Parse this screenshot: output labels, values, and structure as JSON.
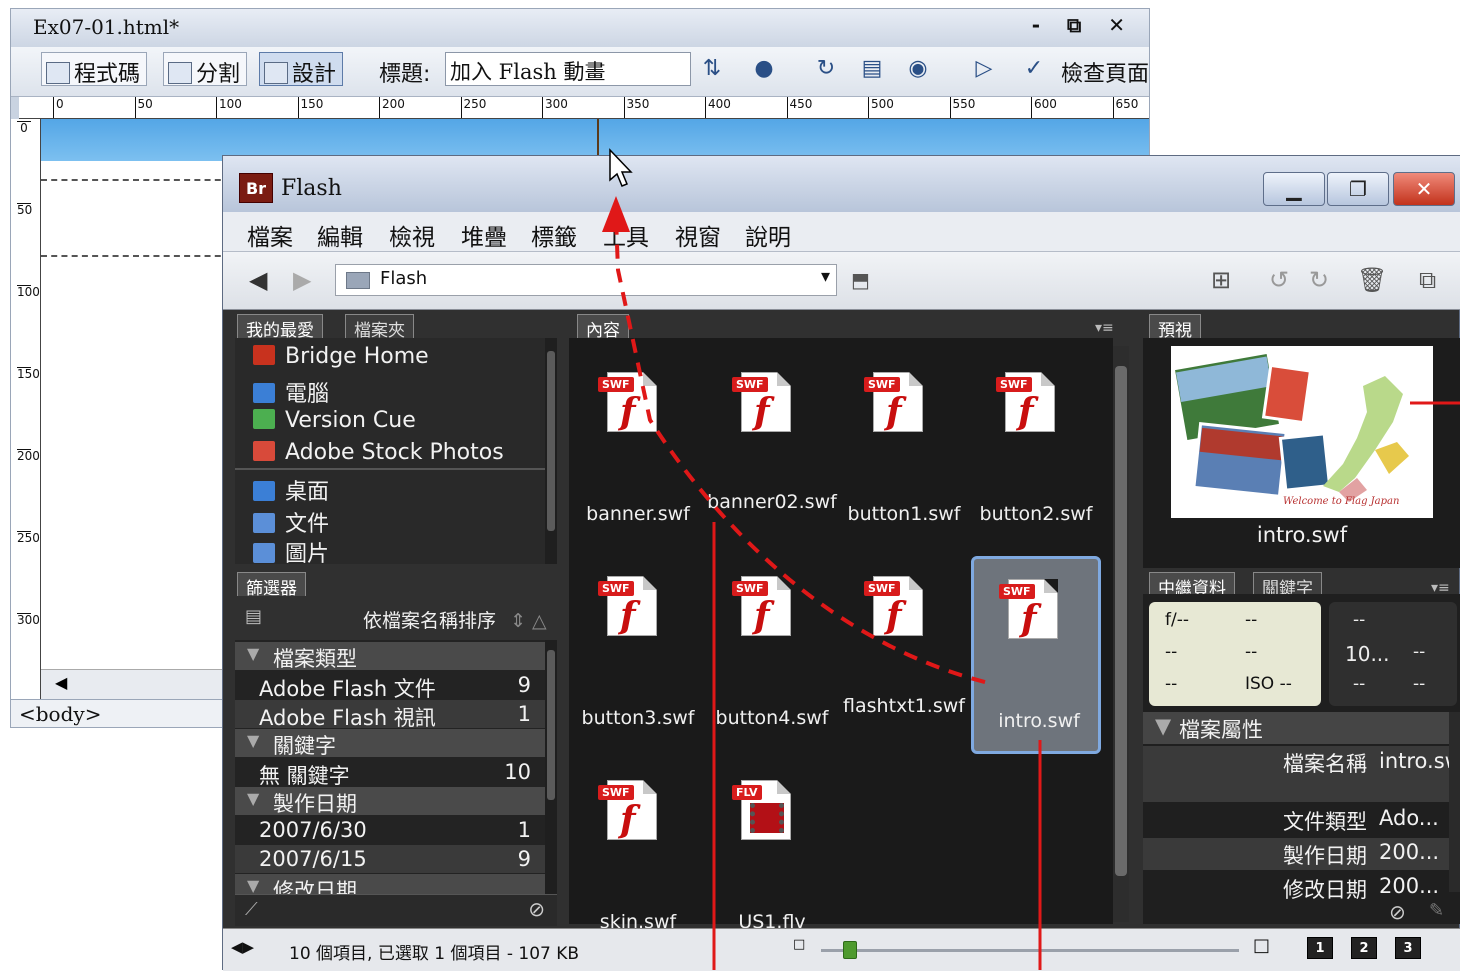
{
  "dreamweaver": {
    "title": "Ex07-01.html*",
    "controls": "- ⧉ ✕",
    "toolbar": {
      "code_label": "程式碼",
      "split_label": "分割",
      "design_label": "設計",
      "title_label": "標題:",
      "title_value": "加入 Flash 動畫",
      "check_page_label": "檢查頁面"
    },
    "ruler_ticks": [
      "0",
      "50",
      "100",
      "150",
      "200",
      "250",
      "300",
      "350",
      "400",
      "450",
      "500",
      "550",
      "600",
      "650"
    ],
    "vruler_ticks": [
      "0",
      "50",
      "100",
      "150",
      "200",
      "250",
      "300"
    ],
    "status_tag": "<body>"
  },
  "bridge": {
    "app_logo": "Br",
    "app_name": "Flash",
    "window_controls": {
      "minimize": "▁",
      "restore": "❐",
      "close": "✕"
    },
    "menu": [
      "檔案",
      "編輯",
      "檢視",
      "堆疊",
      "標籤",
      "工具",
      "視窗",
      "說明"
    ],
    "path": "Flash",
    "favorites_tabs": [
      "我的最愛",
      "檔案夾"
    ],
    "favorites": [
      {
        "label": "Bridge Home",
        "icon": "bridge-home-icon",
        "color": "#c8321e"
      },
      {
        "label": "電腦",
        "icon": "computer-icon",
        "color": "#3b7fd6"
      },
      {
        "label": "Version Cue",
        "icon": "version-cue-icon",
        "color": "#4caf50"
      },
      {
        "label": "Adobe Stock Photos",
        "icon": "stock-photos-icon",
        "color": "#d84a3a"
      },
      {
        "label": "桌面",
        "icon": "desktop-icon",
        "color": "#3b7fd6"
      },
      {
        "label": "文件",
        "icon": "documents-icon",
        "color": "#5b8fd8"
      },
      {
        "label": "圖片",
        "icon": "pictures-icon",
        "color": "#5b8fd8"
      }
    ],
    "filter": {
      "tab": "篩選器",
      "sort_label": "依檔案名稱排序",
      "groups": [
        {
          "title": "檔案類型",
          "rows": [
            {
              "label": "Adobe Flash 文件",
              "count": "9"
            },
            {
              "label": "Adobe Flash 視訊",
              "count": "1"
            }
          ]
        },
        {
          "title": "關鍵字",
          "rows": [
            {
              "label": "無 關鍵字",
              "count": "10"
            }
          ]
        },
        {
          "title": "製作日期",
          "rows": [
            {
              "label": "2007/6/30",
              "count": "1"
            },
            {
              "label": "2007/6/15",
              "count": "9"
            }
          ]
        },
        {
          "title": "修改日期",
          "rows": []
        }
      ]
    },
    "content_tab": "內容",
    "files": [
      {
        "name": "banner.swf",
        "type": "SWF"
      },
      {
        "name": "banner02.swf",
        "type": "SWF"
      },
      {
        "name": "button1.swf",
        "type": "SWF"
      },
      {
        "name": "button2.swf",
        "type": "SWF"
      },
      {
        "name": "button3.swf",
        "type": "SWF"
      },
      {
        "name": "button4.swf",
        "type": "SWF"
      },
      {
        "name": "flashtxt1.swf",
        "type": "SWF"
      },
      {
        "name": "intro.swf",
        "type": "SWF",
        "selected": true
      },
      {
        "name": "skin.swf",
        "type": "SWF"
      },
      {
        "name": "US1.flv",
        "type": "FLV"
      }
    ],
    "preview": {
      "tab": "預視",
      "filename": "intro.swf",
      "caption": "Welcome to Flag Japan"
    },
    "metadata": {
      "tabs": [
        "中繼資料",
        "關鍵字"
      ],
      "box1": [
        "f/--",
        "--",
        "--",
        "--",
        "--",
        "ISO --"
      ],
      "box2": [
        "--",
        "10...",
        "--",
        "--",
        "--"
      ],
      "section_title": "檔案屬性",
      "rows": [
        {
          "key": "檔案名稱",
          "value": "intro.swf"
        },
        {
          "key": "文件類型",
          "value": "Ado..."
        },
        {
          "key": "製作日期",
          "value": "200..."
        },
        {
          "key": "修改日期",
          "value": "200..."
        }
      ]
    },
    "status_text": "10 個項目, 已選取 1 個項目 - 107 KB",
    "view_buttons": [
      "1",
      "2",
      "3"
    ]
  }
}
